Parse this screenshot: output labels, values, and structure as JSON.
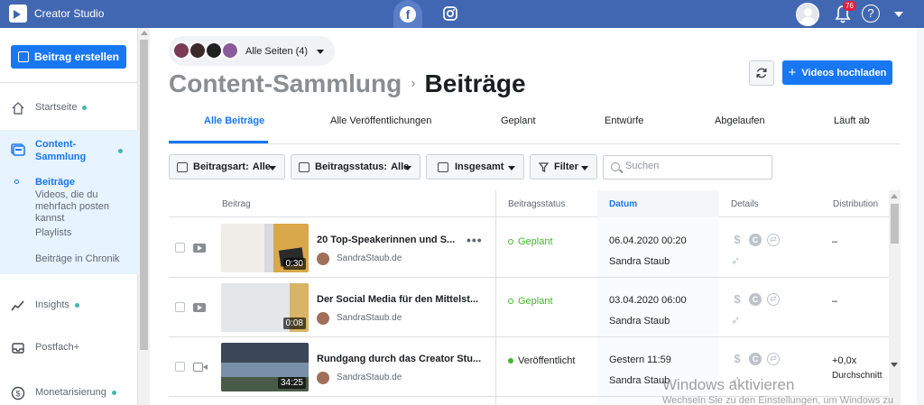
{
  "app": {
    "title": "Creator Studio"
  },
  "topbar": {
    "notification_count": "76",
    "help_label": "?"
  },
  "sidebar": {
    "create_button": "Beitrag erstellen",
    "items": [
      {
        "label": "Startseite",
        "icon": "home-icon"
      },
      {
        "label": "Content-Sammlung",
        "icon": "library-icon"
      },
      {
        "label": "Insights",
        "icon": "chart-icon"
      },
      {
        "label": "Postfach+",
        "icon": "inbox-icon"
      },
      {
        "label": "Monetarisierung",
        "icon": "dollar-icon"
      }
    ],
    "sub_items": [
      {
        "label": "Beiträge"
      },
      {
        "label": "Videos, die du mehrfach posten kannst"
      },
      {
        "label": "Playlists"
      },
      {
        "label": "Beiträge in Chronik"
      }
    ]
  },
  "pages_selector": {
    "label": "Alle Seiten (4)"
  },
  "breadcrumb": {
    "parent": "Content-Sammlung",
    "separator": "›",
    "current": "Beiträge"
  },
  "actions": {
    "upload_label": "Videos hochladen"
  },
  "tabs": [
    {
      "label": "Alle Beiträge"
    },
    {
      "label": "Alle Veröffentlichungen"
    },
    {
      "label": "Geplant"
    },
    {
      "label": "Entwürfe"
    },
    {
      "label": "Abgelaufen"
    },
    {
      "label": "Läuft ab"
    }
  ],
  "filters": {
    "post_type": {
      "label": "Beitragsart:",
      "value": "Alle"
    },
    "post_status": {
      "label": "Beitragsstatus:",
      "value": "Alle"
    },
    "total": {
      "label": "Insgesamt"
    },
    "filter": {
      "label": "Filter"
    },
    "search": {
      "placeholder": "Suchen",
      "value": ""
    }
  },
  "table": {
    "columns": [
      "Beitrag",
      "Beitragsstatus",
      "Datum",
      "Details",
      "Distribution"
    ],
    "rows": [
      {
        "title": "20 Top-Speakerinnen und S...",
        "source": "SandraStaub.de",
        "duration": "0:30",
        "status": "Geplant",
        "date": "06.04.2020 00:20",
        "author": "Sandra Staub",
        "distribution": "–",
        "distribution_note": "",
        "type": "video",
        "thumb_color": "#e8c47a"
      },
      {
        "title": "Der Social Media für den Mittelst...",
        "source": "SandraStaub.de",
        "duration": "0:08",
        "status": "Geplant",
        "date": "03.04.2020 06:00",
        "author": "Sandra Staub",
        "distribution": "–",
        "distribution_note": "",
        "type": "video",
        "thumb_color": "#d8b466"
      },
      {
        "title": "Rundgang durch das Creator Stu...",
        "source": "SandraStaub.de",
        "duration": "34:25",
        "status": "Veröffentlicht",
        "date": "Gestern 11:59",
        "author": "Sandra Staub",
        "distribution": "+0,0x",
        "distribution_note": "Durchschnitt",
        "type": "live",
        "thumb_color": "#5a6a7e"
      }
    ]
  },
  "watermark": {
    "line1": "Windows aktivieren",
    "line2": "Wechseln Sie zu den Einstellungen, um Windows zu"
  },
  "colors": {
    "topbar": "#4267b2",
    "accent": "#1877f2",
    "status_green": "#42b72a"
  }
}
